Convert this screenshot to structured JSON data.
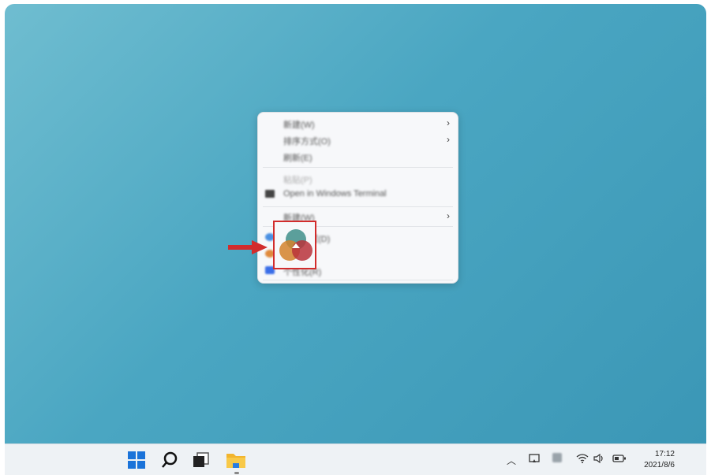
{
  "context_menu": {
    "items": [
      {
        "label": "新建(W)",
        "has_submenu": true
      },
      {
        "label": "排序方式(O)",
        "has_submenu": true
      },
      {
        "label": "刷新(E)",
        "has_submenu": false
      },
      {
        "label": "粘贴(P)",
        "has_submenu": false,
        "disabled": true
      },
      {
        "label": "Open in Windows Terminal",
        "has_submenu": false
      },
      {
        "label": "新建(W)",
        "has_submenu": true
      },
      {
        "label": "显示设置(D)",
        "has_submenu": false
      },
      {
        "label": "",
        "has_submenu": false
      },
      {
        "label": "个性化(R)",
        "has_submenu": false
      }
    ]
  },
  "taskbar": {
    "time": "17:12",
    "date": "2021/8/6"
  },
  "colors": {
    "desktop_bg": "#4aa6c2",
    "highlight": "#d22c2c"
  }
}
